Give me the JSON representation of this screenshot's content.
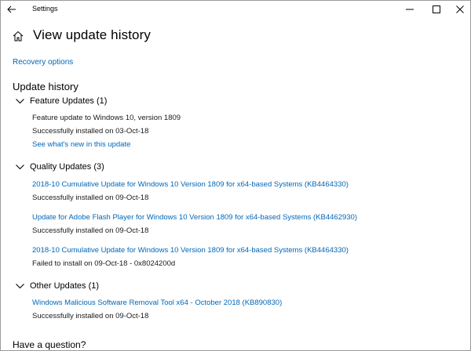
{
  "window": {
    "title": "Settings",
    "controls": {
      "minimize": "minimize-icon",
      "maximize": "maximize-icon",
      "close": "close-icon"
    }
  },
  "header": {
    "title": "View update history",
    "recovery_link": "Recovery options"
  },
  "history": {
    "title": "Update history",
    "groups": [
      {
        "label": "Feature Updates (1)",
        "items": [
          {
            "name": "Feature update to Windows 10, version 1809",
            "status": "Successfully installed on 03-Oct-18",
            "link": "See what's new in this update"
          }
        ]
      },
      {
        "label": "Quality Updates (3)",
        "items": [
          {
            "name": "2018-10 Cumulative Update for Windows 10 Version 1809 for x64-based Systems (KB4464330)",
            "status": "Successfully installed on 09-Oct-18"
          },
          {
            "name": "Update for Adobe Flash Player for Windows 10 Version 1809 for x64-based Systems (KB4462930)",
            "status": "Successfully installed on 09-Oct-18"
          },
          {
            "name": "2018-10 Cumulative Update for Windows 10 Version 1809 for x64-based Systems (KB4464330)",
            "status": "Failed to install on 09-Oct-18 - 0x8024200d"
          }
        ]
      },
      {
        "label": "Other Updates (1)",
        "items": [
          {
            "name": "Windows Malicious Software Removal Tool x64 - October 2018 (KB890830)",
            "status": "Successfully installed on 09-Oct-18"
          }
        ]
      }
    ]
  },
  "footer": {
    "question": "Have a question?"
  },
  "colors": {
    "link": "#0067b8",
    "text": "#000000",
    "background": "#ffffff"
  }
}
